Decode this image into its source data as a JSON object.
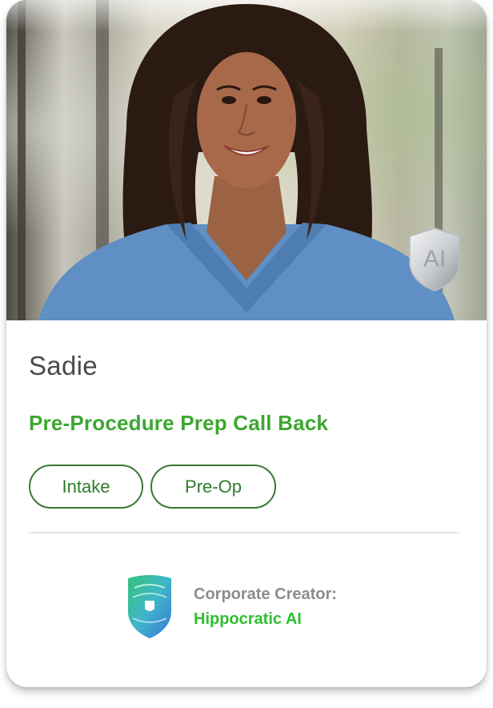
{
  "profile": {
    "name": "Sadie",
    "role": "Pre-Procedure Prep Call Back",
    "photo_icon": "nurse-portrait-photo",
    "badge_text": "AI"
  },
  "tags": [
    {
      "label": "Intake"
    },
    {
      "label": "Pre-Op"
    }
  ],
  "creator": {
    "label": "Corporate Creator:",
    "organization": "Hippocratic AI",
    "logo_icon": "hippocratic-shield-logo"
  },
  "colors": {
    "role_green": "#3ba72f",
    "tag_border": "#3a7a35",
    "org_green": "#2fbf2f",
    "name_gray": "#4a4a4a",
    "scrubs_blue": "#5f8fc4"
  }
}
